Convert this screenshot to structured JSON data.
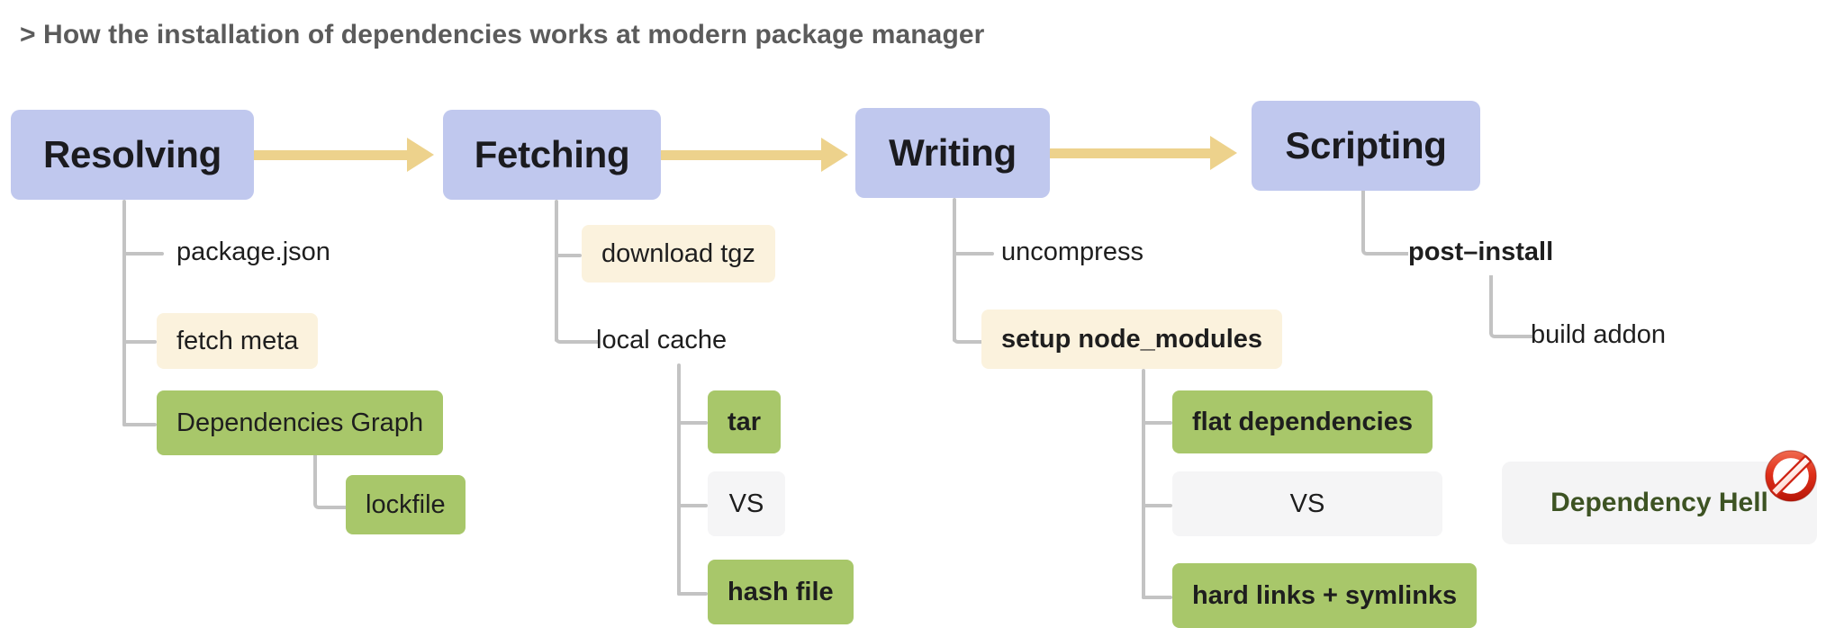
{
  "title": "> How the installation of dependencies works at modern package manager",
  "colors": {
    "stage_bg": "#c0c8ee",
    "arrow": "#edd28c",
    "cream": "#fbf2dd",
    "green": "#a8c76a",
    "grey": "#f5f5f6",
    "connector": "#c3c3c3",
    "hell_text": "#3d5323",
    "title_text": "#5b5b5b"
  },
  "diagram": {
    "type": "flow-tree",
    "stages": [
      {
        "id": "resolving",
        "label": "Resolving"
      },
      {
        "id": "fetching",
        "label": "Fetching"
      },
      {
        "id": "writing",
        "label": "Writing"
      },
      {
        "id": "scripting",
        "label": "Scripting"
      }
    ],
    "arrows": [
      {
        "from": "Resolving",
        "to": "Fetching"
      },
      {
        "from": "Fetching",
        "to": "Writing"
      },
      {
        "from": "Writing",
        "to": "Scripting"
      }
    ],
    "branches": {
      "resolving": [
        {
          "label": "package.json",
          "style": "plain"
        },
        {
          "label": "fetch meta",
          "style": "cream"
        },
        {
          "label": "Dependencies Graph",
          "style": "green",
          "children": [
            {
              "label": "lockfile",
              "style": "green"
            }
          ]
        }
      ],
      "fetching": [
        {
          "label": "download tgz",
          "style": "cream"
        },
        {
          "label": "local cache",
          "style": "plain",
          "children": [
            {
              "label": "tar",
              "style": "green",
              "bold": true
            },
            {
              "label": "VS",
              "style": "grey"
            },
            {
              "label": "hash file",
              "style": "green",
              "bold": true
            }
          ]
        }
      ],
      "writing": [
        {
          "label": "uncompress",
          "style": "plain"
        },
        {
          "label": "setup node_modules",
          "style": "cream",
          "bold": true,
          "children": [
            {
              "label": "flat dependencies",
              "style": "green",
              "bold": true
            },
            {
              "label": "VS",
              "style": "grey"
            },
            {
              "label": "hard links + symlinks",
              "style": "green",
              "bold": true
            }
          ]
        }
      ],
      "scripting": [
        {
          "label": "post–install",
          "style": "plain",
          "bold": true,
          "children": [
            {
              "label": "build addon",
              "style": "plain"
            }
          ]
        }
      ]
    },
    "callout": {
      "label": "Dependency Hell",
      "icon": "no-entry-icon"
    }
  }
}
